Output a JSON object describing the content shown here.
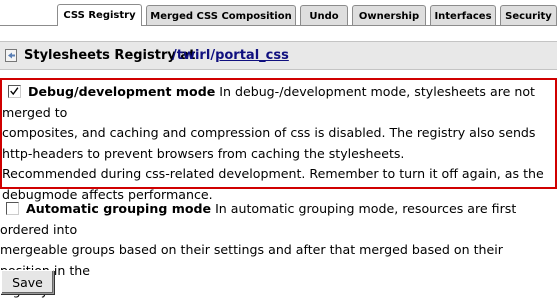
{
  "tabs": [
    {
      "label": "CSS Registry",
      "active": true
    },
    {
      "label": "Merged CSS Composition",
      "active": false
    },
    {
      "label": "Undo",
      "active": false
    },
    {
      "label": "Ownership",
      "active": false
    },
    {
      "label": "Interfaces",
      "active": false
    },
    {
      "label": "Security",
      "active": false
    }
  ],
  "header": {
    "title": "Stylesheets Registry at",
    "path_sep1": "/",
    "path_seg1": "twirl",
    "path_sep2": "/",
    "path_seg2": "portal_css",
    "icon": "registry-icon"
  },
  "options": [
    {
      "checked": true,
      "title": "Debug/development mode",
      "description_lines": [
        " In debug-/development mode, stylesheets are not merged to",
        "composites, and caching and compression of css is disabled. The registry also sends",
        "http-headers to prevent browsers from caching the stylesheets.",
        "Recommended during css-related development. Remember to turn it off again, as the",
        "debugmode affects performance."
      ]
    },
    {
      "checked": false,
      "title": "Automatic grouping mode",
      "description_lines": [
        " In automatic grouping mode, resources are first ordered into",
        "mergeable groups based on their settings and after that merged based on their position in the",
        "registry."
      ]
    }
  ],
  "save_label": "Save",
  "colors": {
    "highlight_border": "#d00000",
    "link": "#10107f",
    "tab_inactive": "#dedede",
    "header_bg": "#e8e8e8"
  }
}
